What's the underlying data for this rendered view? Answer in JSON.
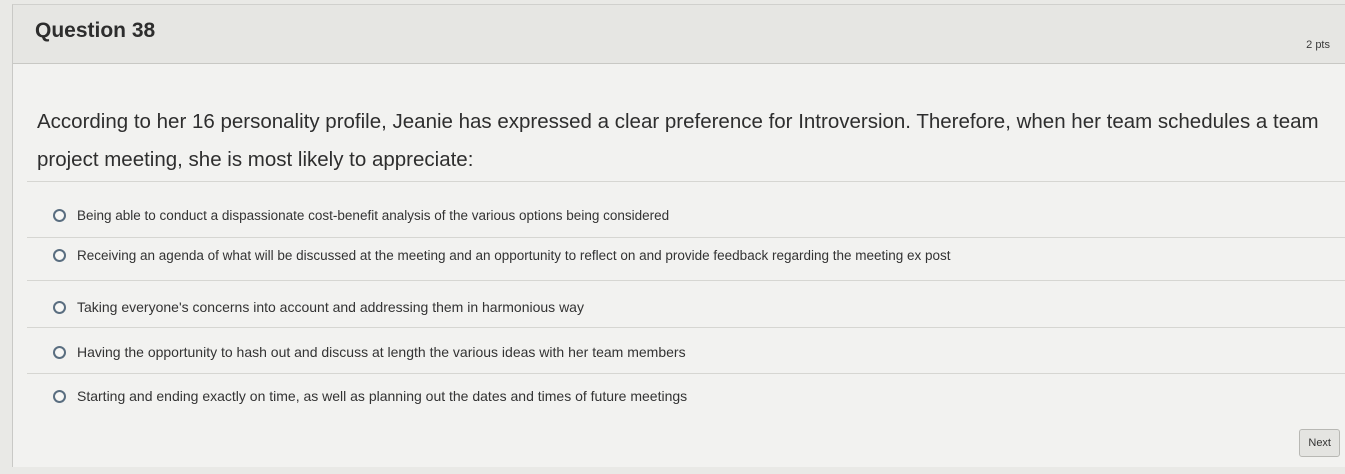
{
  "question": {
    "title": "Question 38",
    "points": "2 pts",
    "text": "According to her 16 personality profile, Jeanie has expressed a clear preference for Introversion. Therefore, when her team schedules a team project meeting, she is most likely to appreciate:"
  },
  "answers": [
    {
      "label": "Being able to conduct a dispassionate cost-benefit analysis of the various options being considered"
    },
    {
      "label": "Receiving an agenda of what will be discussed at the meeting and an opportunity to reflect on and provide feedback regarding the meeting ex post"
    },
    {
      "label": "Taking everyone's concerns into account and addressing them in harmonious way"
    },
    {
      "label": "Having the opportunity to hash out and discuss at length the various ideas with her team members"
    },
    {
      "label": "Starting and ending exactly on time, as well as planning out the dates and times of future meetings"
    }
  ],
  "footer": {
    "next_label": "Next"
  }
}
